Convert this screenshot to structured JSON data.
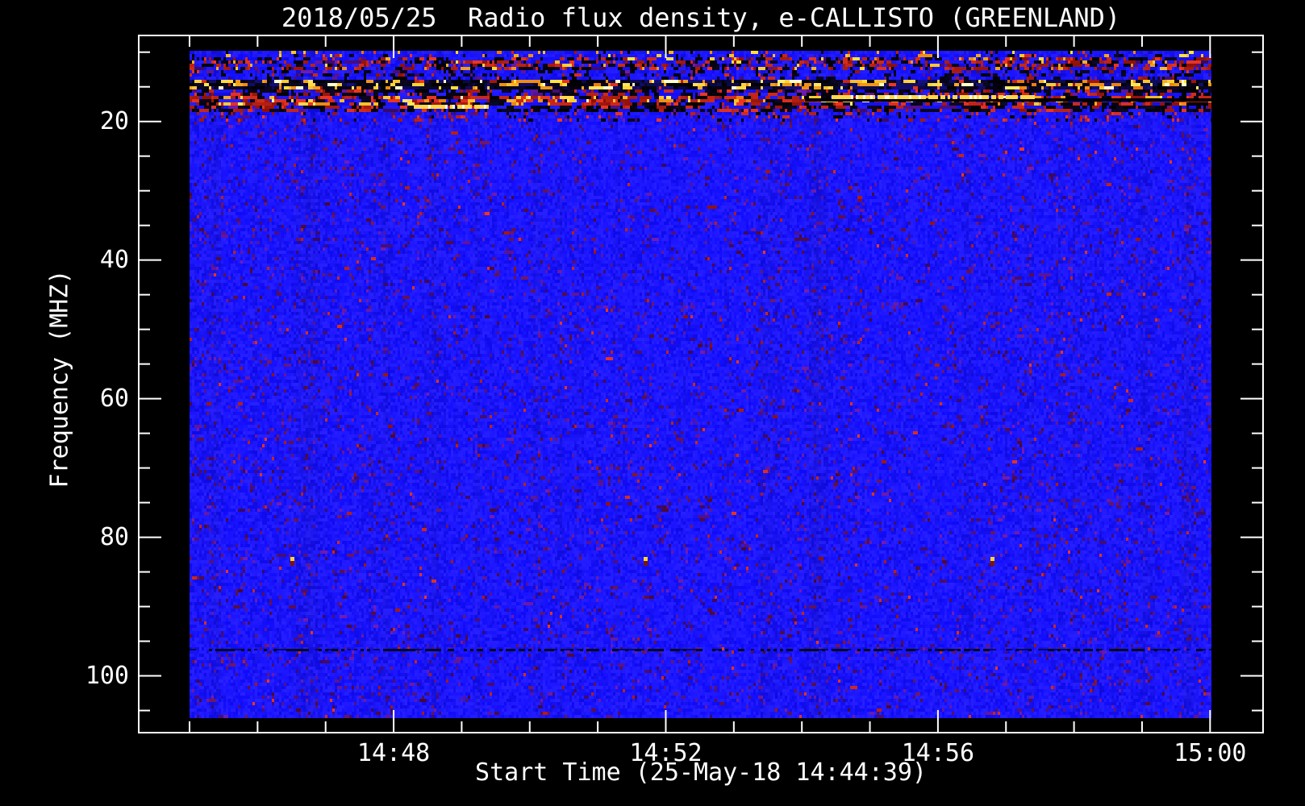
{
  "page": {
    "background": "#000000"
  },
  "chart_data": {
    "type": "heatmap",
    "subtype": "radio-spectrogram",
    "title": "2018/05/25  Radio flux density, e-CALLISTO (GREENLAND)",
    "xlabel": "Start Time (25-May-18 14:44:39)",
    "ylabel": "Frequency (MHZ)",
    "legend": "none",
    "grid": "off",
    "x_axis": {
      "units": "time (HH:MM)",
      "data_start_minute": 45.0,
      "data_end_minute": 60.02,
      "major_ticks": [
        {
          "minute": 48,
          "label": "14:48"
        },
        {
          "minute": 52,
          "label": "14:52"
        },
        {
          "minute": 56,
          "label": "14:56"
        },
        {
          "minute": 60,
          "label": "15:00"
        }
      ],
      "minor_tick_step_minutes": 1,
      "minor_tick_range_minutes": [
        45,
        60
      ]
    },
    "y_axis": {
      "units": "MHz",
      "min_mhz": 9.8,
      "max_mhz": 106.1,
      "inverted": true,
      "major_ticks": [
        {
          "mhz": 20,
          "label": "20"
        },
        {
          "mhz": 40,
          "label": "40"
        },
        {
          "mhz": 60,
          "label": "60"
        },
        {
          "mhz": 80,
          "label": "80"
        },
        {
          "mhz": 100,
          "label": "100"
        }
      ],
      "minor_tick_step_mhz": 5,
      "minor_tick_range_mhz": [
        10,
        105
      ]
    },
    "colors": {
      "page_background": "#000000",
      "frame_and_text": "#ffffff",
      "base_noise_blue": "#1c1ce8",
      "speckle_purple": "#5a1488",
      "speckle_maroon": "#5a1448",
      "rfi_red": "#d42a10",
      "rfi_orange": "#ff9820",
      "rfi_bright_yellow": "#ffe080",
      "rfi_black": "#000010",
      "cal_dot_yellow": "#ffd435",
      "cal_dot_dark_red": "#7a1410"
    },
    "rfi_bands_mhz": [
      {
        "from": 9.8,
        "to": 10.7,
        "style": "top_speck",
        "desc": "blue with sparse orange/red speckles"
      },
      {
        "from": 10.7,
        "to": 12.7,
        "style": "heavy_mix",
        "desc": "dense red/dark/blue interference"
      },
      {
        "from": 12.7,
        "to": 14.1,
        "style": "blue_dark",
        "desc": "blue with dark patches"
      },
      {
        "from": 14.1,
        "to": 15.5,
        "style": "bright_dashes",
        "desc": "dark band with bright orange/yellow dashes"
      },
      {
        "from": 15.5,
        "to": 16.7,
        "style": "dark_red",
        "desc": "black patches with red dashes"
      },
      {
        "from": 16.7,
        "to": 17.7,
        "style": "red_band",
        "desc": "strong red band with bright segments"
      },
      {
        "from": 17.7,
        "to": 18.8,
        "style": "dark_red",
        "desc": "red/dark speckled band"
      },
      {
        "from": 18.8,
        "to": 19.6,
        "style": "fade",
        "desc": "transition to quiet blue background"
      }
    ],
    "features": {
      "black_interference_line": {
        "mhz": 16.8,
        "from_minute": 54.05,
        "to_minute": 60.02
      },
      "bright_streaks": [
        {
          "mhz": 16.4,
          "from_minute": 54.4,
          "to_minute": 57.4
        },
        {
          "mhz": 17.8,
          "from_minute": 48.3,
          "to_minute": 49.4
        }
      ],
      "calibration_dots": {
        "mhz": 83,
        "minutes": [
          46.5,
          51.7,
          56.8
        ]
      },
      "dark_dashed_line_mhz": 96.1
    }
  }
}
